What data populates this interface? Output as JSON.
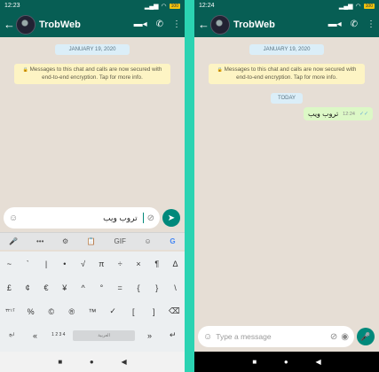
{
  "left": {
    "status": {
      "time": "12:23",
      "signal": "▂▄▆",
      "wifi": "◠",
      "battery": "100"
    },
    "header": {
      "back": "←",
      "title": "TrobWeb",
      "video_icon": "▬◂",
      "call_icon": "✆",
      "menu_icon": "⋮"
    },
    "chat": {
      "date": "JANUARY 19, 2020",
      "lock": "🔒",
      "notice": "Messages to this chat and calls are now secured with end-to-end encryption. Tap for more info."
    },
    "composer": {
      "emoji_icon": "☺",
      "typed_text": "تروب ويب",
      "clip_icon": "⊘",
      "send_icon": "➤"
    },
    "keyboard_toolbar": [
      "🎤",
      "•••",
      "⚙",
      "📋",
      "GIF",
      "☺",
      "G"
    ],
    "keyboard_rows": [
      [
        "~",
        "`",
        "|",
        "•",
        "√",
        "π",
        "÷",
        "×",
        "¶",
        "Δ"
      ],
      [
        "£",
        "¢",
        "€",
        "¥",
        "^",
        "°",
        "=",
        "{",
        "}",
        "\\"
      ],
      [
        "؟٣٢١",
        "%",
        "©",
        "®",
        "™",
        "✓",
        "[",
        "]",
        "⌫"
      ],
      [
        "ابج",
        "«",
        "1 2 3 4",
        "العربية",
        "»",
        "↵"
      ]
    ],
    "nav": {
      "square": "■",
      "circle": "●",
      "triangle": "◀"
    }
  },
  "right": {
    "status": {
      "time": "12:24",
      "signal": "▂▄▆",
      "wifi": "◠",
      "battery": "100"
    },
    "header": {
      "back": "←",
      "title": "TrobWeb",
      "video_icon": "▬◂",
      "call_icon": "✆",
      "menu_icon": "⋮"
    },
    "chat": {
      "date": "JANUARY 19, 2020",
      "lock": "🔒",
      "notice": "Messages to this chat and calls are now secured with end-to-end encryption. Tap for more info.",
      "today": "TODAY",
      "message": {
        "text": "تروب ويب",
        "time": "12:24",
        "ticks": "✓✓"
      }
    },
    "composer": {
      "emoji_icon": "☺",
      "placeholder": "Type a message",
      "clip_icon": "⊘",
      "camera_icon": "◉",
      "mic_icon": "🎤"
    },
    "nav": {
      "square": "■",
      "circle": "●",
      "triangle": "◀"
    }
  }
}
